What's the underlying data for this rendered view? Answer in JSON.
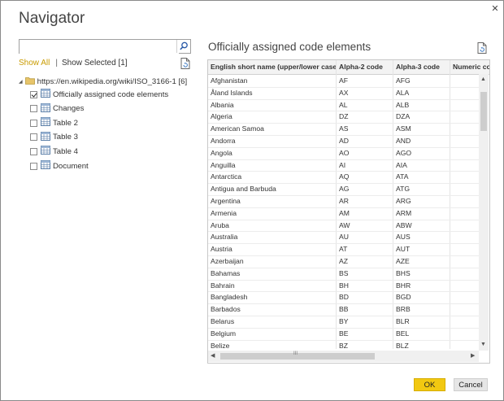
{
  "window": {
    "title": "Navigator",
    "close_glyph": "✕"
  },
  "search": {
    "value": "",
    "placeholder": ""
  },
  "filters": {
    "show_all": "Show All",
    "separator": "|",
    "show_selected": "Show Selected [1]"
  },
  "tree": {
    "root": {
      "label": "https://en.wikipedia.org/wiki/ISO_3166-1 [6]",
      "expand_glyph": "◢"
    },
    "items": [
      {
        "label": "Officially assigned code elements",
        "checked": true
      },
      {
        "label": "Changes",
        "checked": false
      },
      {
        "label": "Table 2",
        "checked": false
      },
      {
        "label": "Table 3",
        "checked": false
      },
      {
        "label": "Table 4",
        "checked": false
      },
      {
        "label": "Document",
        "checked": false
      }
    ]
  },
  "preview": {
    "title": "Officially assigned code elements",
    "columns": [
      "English short name (upper/lower case)",
      "Alpha-2 code",
      "Alpha-3 code",
      "Numeric code"
    ],
    "rows": [
      [
        "Afghanistan",
        "AF",
        "AFG"
      ],
      [
        "Åland Islands",
        "AX",
        "ALA"
      ],
      [
        "Albania",
        "AL",
        "ALB"
      ],
      [
        "Algeria",
        "DZ",
        "DZA"
      ],
      [
        "American Samoa",
        "AS",
        "ASM"
      ],
      [
        "Andorra",
        "AD",
        "AND"
      ],
      [
        "Angola",
        "AO",
        "AGO"
      ],
      [
        "Anguilla",
        "AI",
        "AIA"
      ],
      [
        "Antarctica",
        "AQ",
        "ATA"
      ],
      [
        "Antigua and Barbuda",
        "AG",
        "ATG"
      ],
      [
        "Argentina",
        "AR",
        "ARG"
      ],
      [
        "Armenia",
        "AM",
        "ARM"
      ],
      [
        "Aruba",
        "AW",
        "ABW"
      ],
      [
        "Australia",
        "AU",
        "AUS"
      ],
      [
        "Austria",
        "AT",
        "AUT"
      ],
      [
        "Azerbaijan",
        "AZ",
        "AZE"
      ],
      [
        "Bahamas",
        "BS",
        "BHS"
      ],
      [
        "Bahrain",
        "BH",
        "BHR"
      ],
      [
        "Bangladesh",
        "BD",
        "BGD"
      ],
      [
        "Barbados",
        "BB",
        "BRB"
      ],
      [
        "Belarus",
        "BY",
        "BLR"
      ],
      [
        "Belgium",
        "BE",
        "BEL"
      ],
      [
        "Belize",
        "BZ",
        "BLZ"
      ]
    ],
    "hscroll_thumb_glyph": "III",
    "arrows": {
      "up": "▲",
      "down": "▼",
      "left": "◀",
      "right": "▶"
    }
  },
  "buttons": {
    "ok": "OK",
    "cancel": "Cancel"
  },
  "colors": {
    "accent": "#f2c811",
    "link": "#c99b00"
  },
  "icons": [
    "search-icon",
    "folder-icon",
    "table-icon",
    "page-refresh-icon",
    "close-icon"
  ]
}
